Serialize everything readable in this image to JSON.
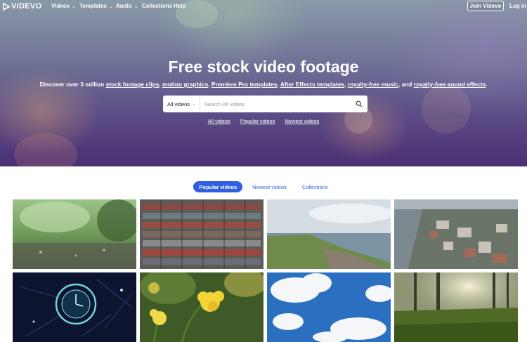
{
  "nav": {
    "logo": "VIDEVO",
    "items": [
      {
        "label": "Videos",
        "dropdown": true
      },
      {
        "label": "Templates",
        "dropdown": true
      },
      {
        "label": "Audio",
        "dropdown": true
      },
      {
        "label": "Collections",
        "dropdown": false
      },
      {
        "label": "Help",
        "dropdown": false
      }
    ],
    "join_label": "Join Videvo",
    "login_label": "Log in"
  },
  "hero": {
    "title": "Free stock video footage",
    "sub_prefix": "Discover over 3 million ",
    "links": [
      "stock footage clips",
      "motion graphics",
      "Premiere Pro templates",
      "After Effects templates",
      "royalty-free music",
      "royalty-free sound effects"
    ],
    "sep": ", ",
    "and": ", and ",
    "end": "."
  },
  "search": {
    "select_value": "All videos",
    "placeholder": "Search All videos",
    "icon": "search-icon"
  },
  "quick_links": [
    "All videos",
    "Popular videos",
    "Newest videos"
  ],
  "tabs": [
    {
      "label": "Popular videos",
      "active": true
    },
    {
      "label": "Newest videos",
      "active": false
    },
    {
      "label": "Collections",
      "active": false
    }
  ],
  "colors": {
    "accent": "#2f5fe0",
    "tab_text": "#3a63d9",
    "hero_top": "#8a9aa8",
    "hero_bottom": "#4a2f74"
  },
  "thumbnails": [
    {
      "subject": "rain-forest"
    },
    {
      "subject": "shipping-containers"
    },
    {
      "subject": "coastline"
    },
    {
      "subject": "aerial-city"
    },
    {
      "subject": "digital-clock"
    },
    {
      "subject": "daffodils"
    },
    {
      "subject": "clouds-sky"
    },
    {
      "subject": "forest-grass"
    }
  ]
}
